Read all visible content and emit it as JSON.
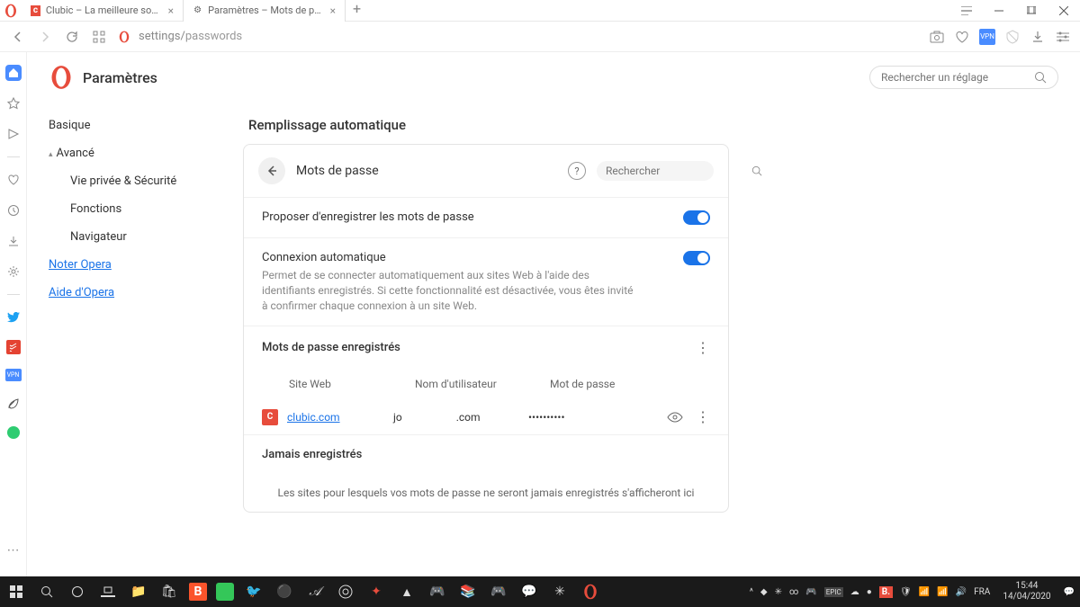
{
  "tabs": [
    {
      "label": "Clubic – La meilleure source",
      "icon": "C"
    },
    {
      "label": "Paramètres – Mots de pass",
      "icon": "⚙"
    }
  ],
  "url": {
    "prefix": "settings/",
    "path": "passwords"
  },
  "page_title": "Paramètres",
  "search_settings_placeholder": "Rechercher un réglage",
  "sidebar": {
    "basic": "Basique",
    "advanced": "Avancé",
    "privacy": "Vie privée & Sécurité",
    "features": "Fonctions",
    "browser": "Navigateur",
    "rate": "Noter Opera",
    "help": "Aide d'Opera"
  },
  "section_title": "Remplissage automatique",
  "card": {
    "title": "Mots de passe",
    "search_placeholder": "Rechercher",
    "offer_save": "Proposer d'enregistrer les mots de passe",
    "auto_signin_title": "Connexion automatique",
    "auto_signin_desc": "Permet de se connecter automatiquement aux sites Web à l'aide des identifiants enregistrés. Si cette fonctionnalité est désactivée, vous êtes invité à confirmer chaque connexion à un site Web.",
    "saved_title": "Mots de passe enregistrés",
    "columns": {
      "site": "Site Web",
      "user": "Nom d'utilisateur",
      "pass": "Mot de passe"
    },
    "entries": [
      {
        "icon": "C",
        "site": "clubic.com",
        "user_left": "jo",
        "user_right": ".com",
        "pass": "••••••••••"
      }
    ],
    "never_title": "Jamais enregistrés",
    "never_empty": "Les sites pour lesquels vos mots de passe ne seront jamais enregistrés s'afficheront ici"
  },
  "taskbar": {
    "lang": "FRA",
    "time": "15:44",
    "date": "14/04/2020"
  }
}
